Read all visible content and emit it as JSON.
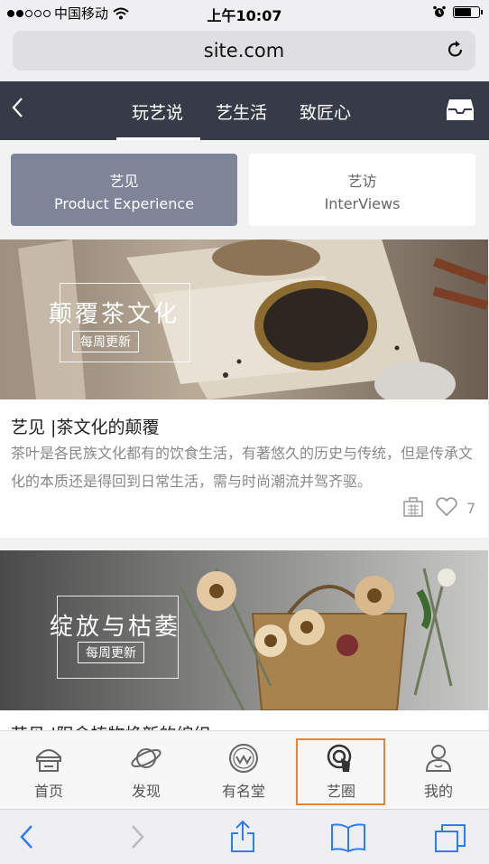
{
  "status_bar": {
    "carrier": "中国移动",
    "time": "上午10:07",
    "battery_level": 0.75
  },
  "browser": {
    "url": "site.com"
  },
  "top_nav": {
    "tabs": [
      {
        "label": "玩艺说"
      },
      {
        "label": "艺生活"
      },
      {
        "label": "致匠心"
      }
    ]
  },
  "segments": [
    {
      "line1": "艺见",
      "line2": "Product Experience"
    },
    {
      "line1": "艺访",
      "line2": "InterViews"
    }
  ],
  "cards": [
    {
      "overlay_title": "颠覆茶文化",
      "overlay_badge": "每周更新",
      "title": "艺见 |茶文化的颠覆",
      "description": "茶叶是各民族文化都有的饮食生活，有著悠久的历史与传统，但是传承文化的本质还是得回到日常生活，需与时尚潮流并驾齐驱。",
      "likes": "7"
    },
    {
      "overlay_title": "绽放与枯萎",
      "overlay_badge": "每周更新",
      "title": "艺见 |阳伞植物焕新的编织"
    }
  ],
  "tab_bar": {
    "items": [
      {
        "label": "首页",
        "icon": "home-icon"
      },
      {
        "label": "发现",
        "icon": "planet-icon"
      },
      {
        "label": "有名堂",
        "icon": "logo-circle-icon"
      },
      {
        "label": "艺圈",
        "icon": "touch-icon"
      },
      {
        "label": "我的",
        "icon": "person-icon"
      }
    ],
    "selected_index": 3,
    "highlight_color": "#e8833a"
  },
  "colors": {
    "nav_bg": "#363b47",
    "segment_active": "#7e8599",
    "safari_blue": "#2e7cf6"
  }
}
